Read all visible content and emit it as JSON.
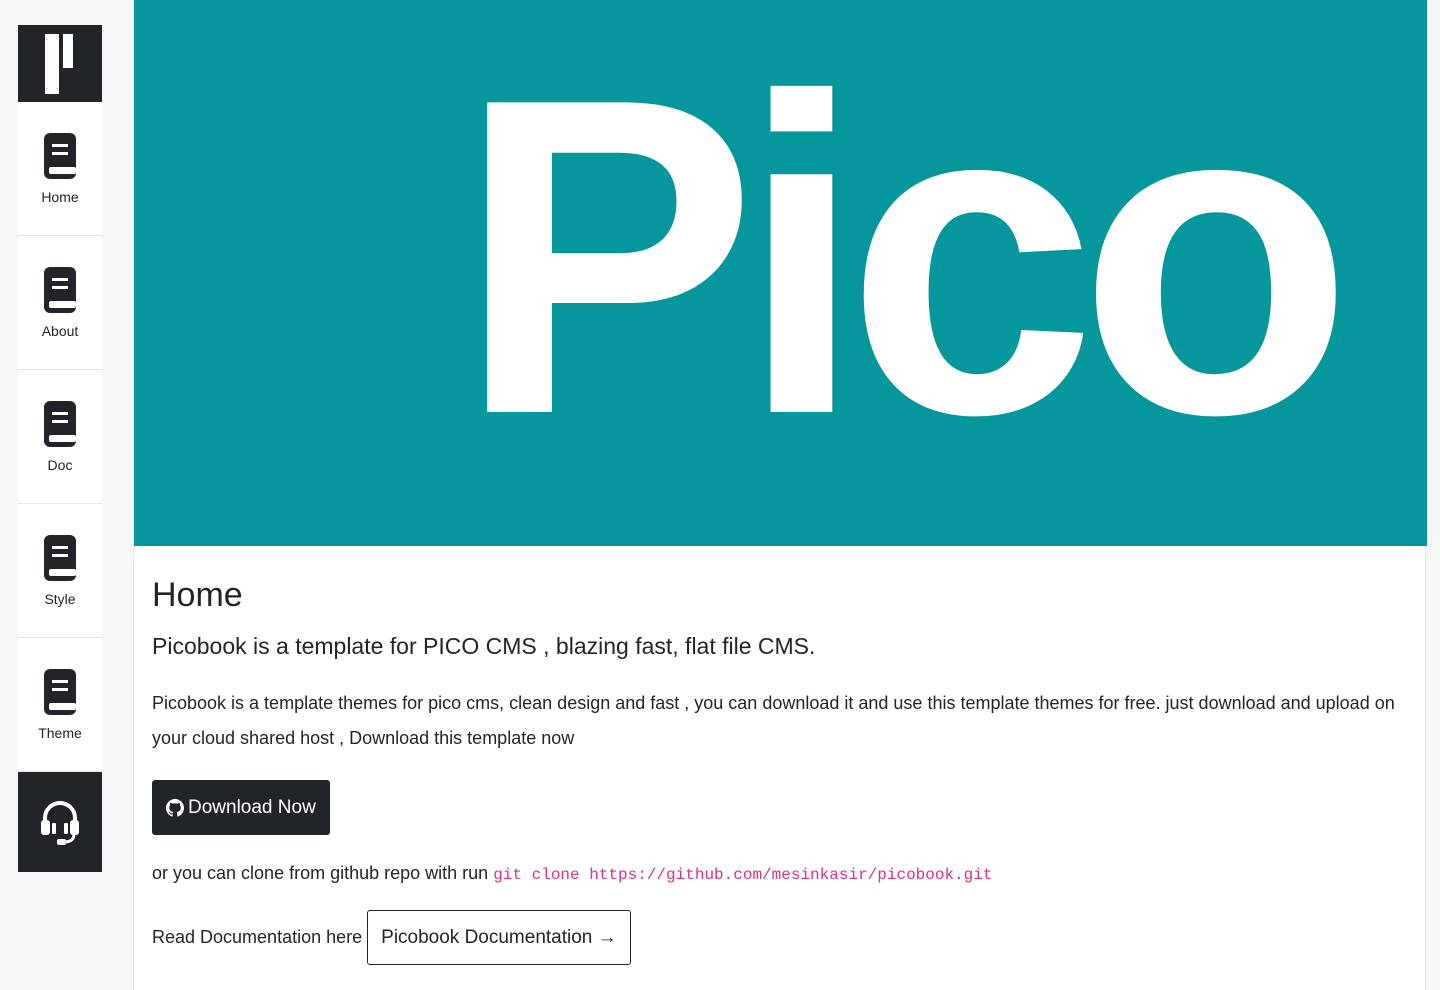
{
  "sidebar": {
    "brand_icon": "picobook-logo-icon",
    "items": [
      {
        "label": "Home",
        "icon": "book-icon"
      },
      {
        "label": "About",
        "icon": "book-icon"
      },
      {
        "label": "Doc",
        "icon": "book-icon"
      },
      {
        "label": "Style",
        "icon": "book-icon"
      },
      {
        "label": "Theme",
        "icon": "book-icon"
      }
    ],
    "support_icon": "headset-icon"
  },
  "hero": {
    "logo_text": "Pico",
    "background_color": "#05979b",
    "text_color": "#ffffff"
  },
  "main": {
    "title": "Home",
    "lead": "Picobook is a template for PICO CMS , blazing fast, flat file CMS.",
    "description": "Picobook is a template themes for pico cms, clean design and fast , you can download it and use this template themes for free. just download and upload on your cloud shared host , Download this template now",
    "download_button": "Download Now",
    "download_icon": "github-icon",
    "clone_text": "or you can clone from github repo with run",
    "clone_command": "git clone https://github.com/mesinkasir/picobook.git",
    "doc_text": "Read Documentation here",
    "doc_button": "Picobook Documentation →"
  },
  "colors": {
    "dark": "#212529",
    "code": "#d63384",
    "teal": "#05979b"
  }
}
